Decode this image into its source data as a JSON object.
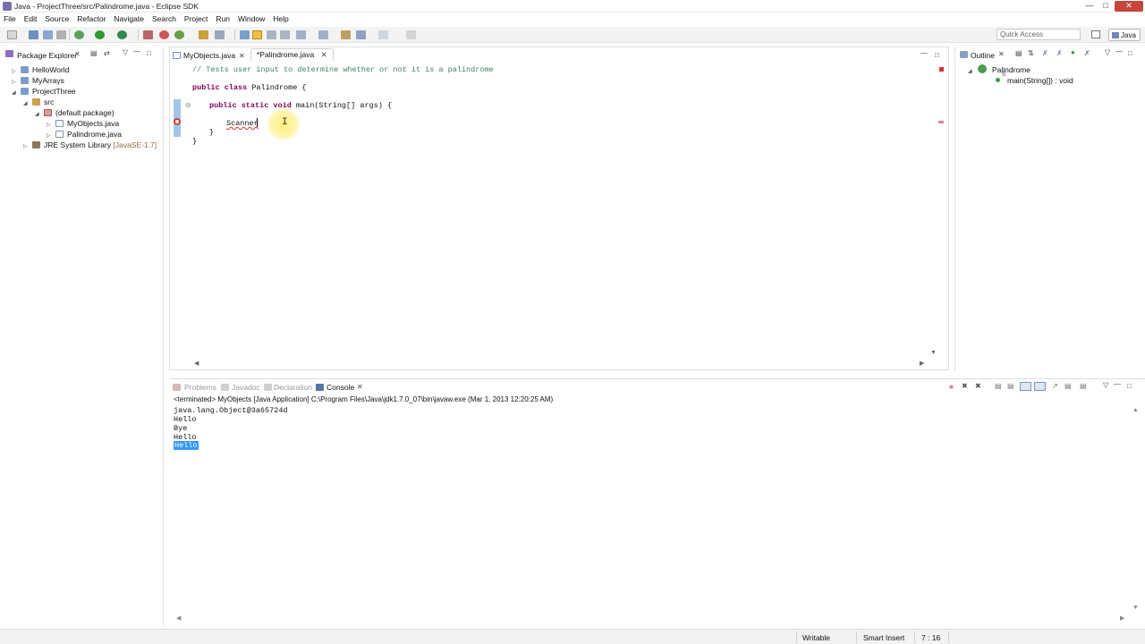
{
  "window": {
    "title": "Java - ProjectThree/src/Palindrome.java - Eclipse SDK"
  },
  "menu": [
    "File",
    "Edit",
    "Source",
    "Refactor",
    "Navigate",
    "Search",
    "Project",
    "Run",
    "Window",
    "Help"
  ],
  "toolbar": {
    "quick_access_placeholder": "Quick Access",
    "perspective": "Java"
  },
  "package_explorer": {
    "title": "Package Explorer",
    "items": [
      {
        "label": "HelloWorld",
        "level": 0
      },
      {
        "label": "MyArrays",
        "level": 0
      },
      {
        "label": "ProjectThree",
        "level": 0
      },
      {
        "label": "src",
        "level": 1
      },
      {
        "label": "(default package)",
        "level": 2
      },
      {
        "label": "MyObjects.java",
        "level": 3
      },
      {
        "label": "Palindrome.java",
        "level": 3
      },
      {
        "label": "JRE System Library",
        "suffix": "[JavaSE-1.7]",
        "level": 1
      }
    ]
  },
  "editor": {
    "tabs": [
      "MyObjects.java",
      "*Palindrome.java"
    ],
    "active_tab": 1,
    "lines": {
      "comment": "// Tests user input to determine whether or not it is a palindrome",
      "class_kw": "public class",
      "class_name": " Palindrome {",
      "method_kw": "public static void",
      "method_sig": " main(String[] args) {",
      "scanner": "Scanner",
      "close_method": "}",
      "close_class": "}"
    }
  },
  "outline": {
    "title": "Outline",
    "items": [
      {
        "label": "Palindrome"
      },
      {
        "label": "main(String[]) : void"
      }
    ]
  },
  "bottom_panel": {
    "tabs": [
      "Problems",
      "Javadoc",
      "Declaration",
      "Console"
    ],
    "active_tab": "Console",
    "header": "<terminated> MyObjects [Java Application] C:\\Program Files\\Java\\jdk1.7.0_07\\bin\\javaw.exe (Mar 1, 2013 12:20:25 AM)",
    "output": [
      "java.lang.Object@3a65724d",
      "Hello",
      "Bye",
      "Hello",
      "Hello"
    ]
  },
  "status": {
    "writable": "Writable",
    "insert_mode": "Smart Insert",
    "position": "7 : 16"
  }
}
